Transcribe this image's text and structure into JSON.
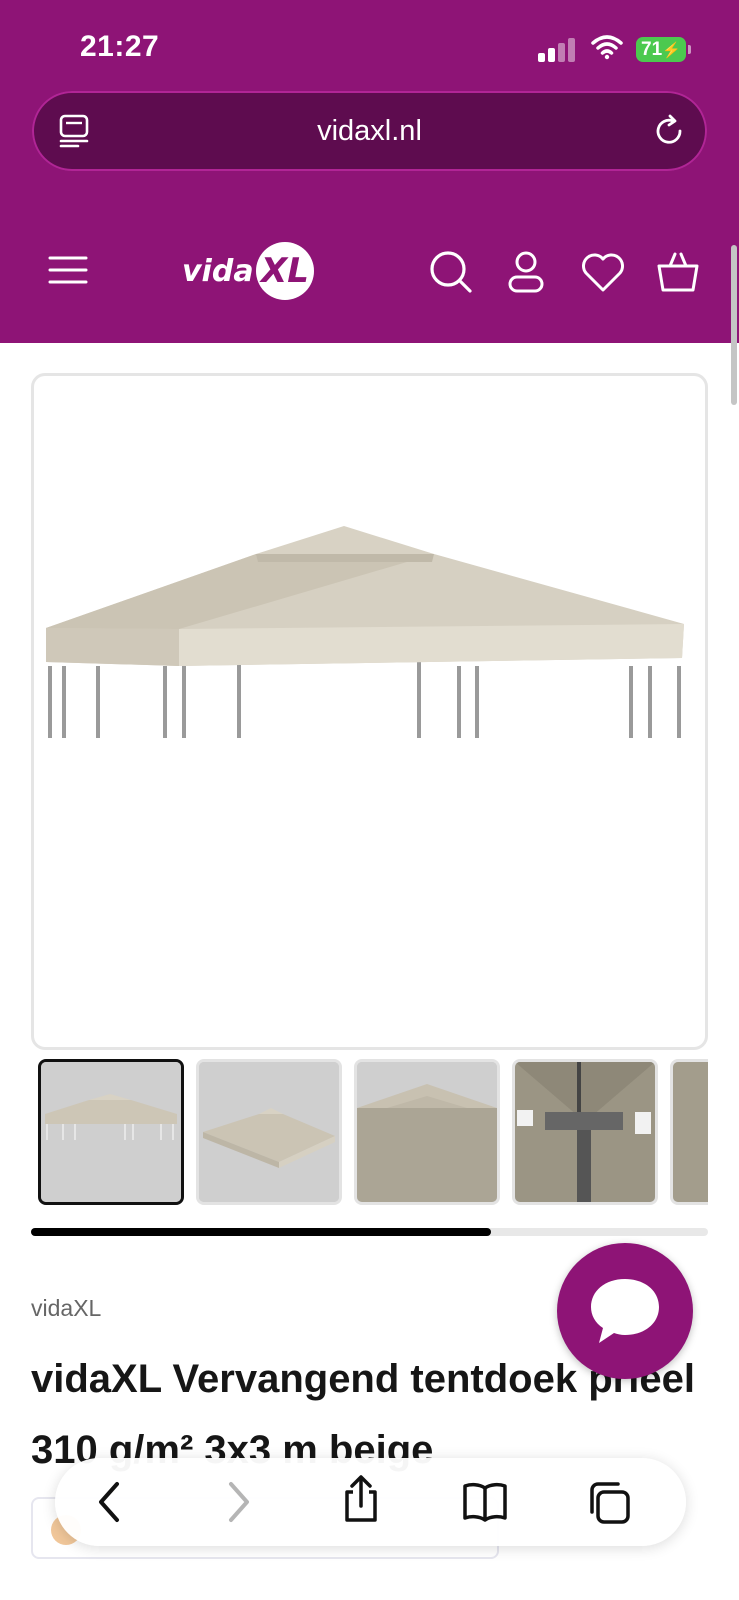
{
  "status_bar": {
    "time": "21:27",
    "battery": "71"
  },
  "browser": {
    "url": "vidaxl.nl"
  },
  "site_header": {
    "logo_text": "vida",
    "logo_mark": "XL"
  },
  "product": {
    "brand": "vidaXL",
    "title": "vidaXL Vervangend tentdoek prieel 310 g/m² 3x3 m beige",
    "gallery_scroll_progress": 0.68,
    "thumbnail_count": 5,
    "canopy_color": "#dcd6c8"
  },
  "colors": {
    "brand": "#8e1476",
    "urlbar": "#5e0c4f"
  },
  "icons": [
    "tab-overview-icon",
    "reload-icon",
    "menu-icon",
    "search-icon",
    "account-icon",
    "heart-icon",
    "cart-icon",
    "chat-icon",
    "back-icon",
    "forward-icon",
    "share-icon",
    "bookmarks-icon",
    "tabs-icon"
  ]
}
